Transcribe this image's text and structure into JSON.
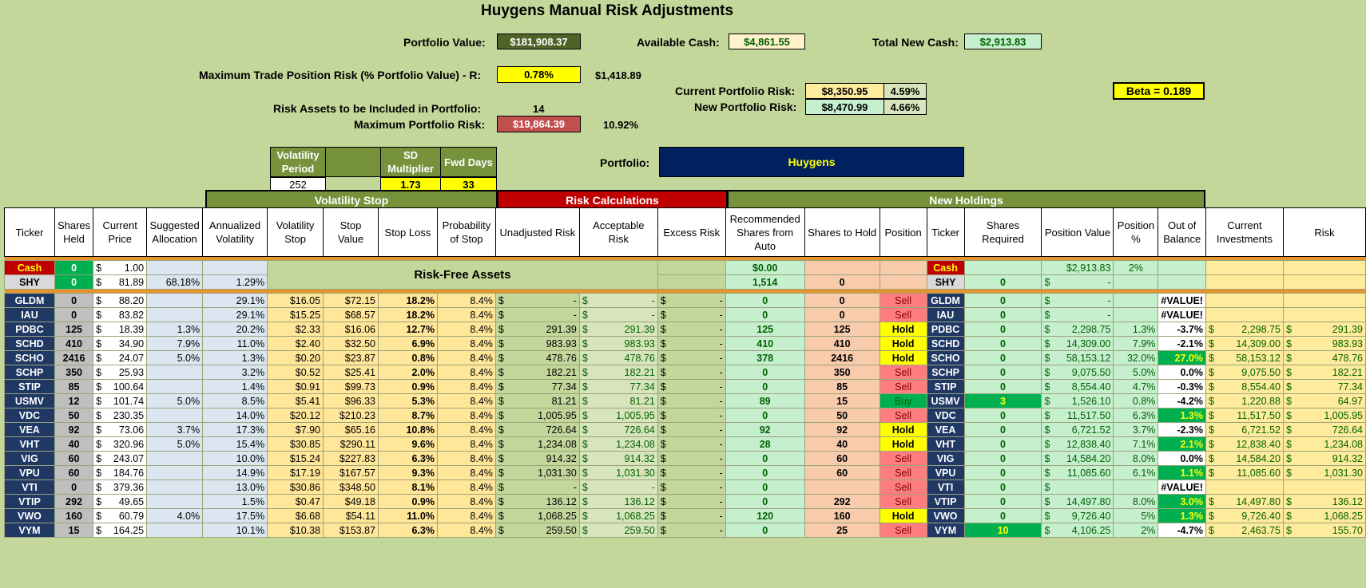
{
  "title": "Huygens Manual Risk Adjustments",
  "portfolio_value": {
    "label": "Portfolio Value:",
    "value": "$181,908.37"
  },
  "available_cash": {
    "label": "Available Cash:",
    "value": "$4,861.55"
  },
  "total_new_cash": {
    "label": "Total New Cash:",
    "value": "$2,913.83"
  },
  "max_trade_risk": {
    "label": "Maximum Trade Position Risk (% Portfolio Value) - R:",
    "pct": "0.78%",
    "amount": "$1,418.89"
  },
  "current_portfolio_risk": {
    "label": "Current Portfolio Risk:",
    "amount": "$8,350.95",
    "pct": "4.59%"
  },
  "new_portfolio_risk": {
    "label": "New Portfolio Risk:",
    "amount": "$8,470.99",
    "pct": "4.66%"
  },
  "beta": "Beta = 0.189",
  "risk_assets": {
    "label": "Risk Assets to be Included in Portfolio:",
    "value": "14"
  },
  "max_portfolio_risk": {
    "label": "Maximum Portfolio Risk:",
    "amount": "$19,864.39",
    "pct": "10.92%"
  },
  "params": {
    "vol_period_label": "Volatility Period",
    "vol_period": "252",
    "sd_label": "SD Multiplier",
    "sd": "1.73",
    "fwd_label": "Fwd Days",
    "fwd": "33"
  },
  "portfolio": {
    "label": "Portfolio:",
    "name": "Huygens"
  },
  "bands": {
    "vol_stop": "Volatility Stop",
    "risk_calc": "Risk Calculations",
    "new_holdings": "New Holdings"
  },
  "headers": [
    "Ticker",
    "Shares Held",
    "Current Price",
    "Suggested Allocation",
    "Annualized Volatility",
    "Volatility Stop",
    "Stop Value",
    "Stop Loss",
    "Probability of Stop",
    "Unadjusted Risk",
    "Acceptable Risk",
    "Excess Risk",
    "Recommended Shares from Auto",
    "Shares to Hold",
    "Position",
    "Ticker",
    "Shares Required",
    "Position Value",
    "Position %",
    "Out of Balance",
    "Current Investments",
    "Risk"
  ],
  "risk_free_label": "Risk-Free Assets",
  "cash_row": {
    "ticker": "Cash",
    "shares": "0",
    "price": "1.00",
    "rec": "$0.00",
    "ticker2": "Cash",
    "pval": "$2,913.83",
    "ppct": "2%"
  },
  "shy_row": {
    "ticker": "SHY",
    "shares": "0",
    "price": "81.89",
    "alloc": "68.18%",
    "vol": "1.29%",
    "rec": "1,514",
    "hold": "0",
    "ticker2": "SHY",
    "sreq": "0",
    "pval": "-"
  },
  "rows": [
    {
      "t": "GLDM",
      "sh": "0",
      "p": "88.20",
      "al": "",
      "av": "29.1%",
      "vs": "$16.05",
      "sv": "$72.15",
      "sl": "18.2%",
      "ps": "8.4%",
      "ur": "-",
      "ar": "-",
      "er": "-",
      "rec": "0",
      "hold": "0",
      "pos": "Sell",
      "sreq": "0",
      "pv": "-",
      "pp": "",
      "oob": "#VALUE!",
      "ci": "",
      "rk": ""
    },
    {
      "t": "IAU",
      "sh": "0",
      "p": "83.82",
      "al": "",
      "av": "29.1%",
      "vs": "$15.25",
      "sv": "$68.57",
      "sl": "18.2%",
      "ps": "8.4%",
      "ur": "-",
      "ar": "-",
      "er": "-",
      "rec": "0",
      "hold": "0",
      "pos": "Sell",
      "sreq": "0",
      "pv": "-",
      "pp": "",
      "oob": "#VALUE!",
      "ci": "",
      "rk": ""
    },
    {
      "t": "PDBC",
      "sh": "125",
      "p": "18.39",
      "al": "1.3%",
      "av": "20.2%",
      "vs": "$2.33",
      "sv": "$16.06",
      "sl": "12.7%",
      "ps": "8.4%",
      "ur": "291.39",
      "ar": "291.39",
      "er": "-",
      "rec": "125",
      "hold": "125",
      "pos": "Hold",
      "sreq": "0",
      "pv": "2,298.75",
      "pp": "1.3%",
      "oob": "-3.7%",
      "ci": "2,298.75",
      "rk": "291.39"
    },
    {
      "t": "SCHD",
      "sh": "410",
      "p": "34.90",
      "al": "7.9%",
      "av": "11.0%",
      "vs": "$2.40",
      "sv": "$32.50",
      "sl": "6.9%",
      "ps": "8.4%",
      "ur": "983.93",
      "ar": "983.93",
      "er": "-",
      "rec": "410",
      "hold": "410",
      "pos": "Hold",
      "sreq": "0",
      "pv": "14,309.00",
      "pp": "7.9%",
      "oob": "-2.1%",
      "ci": "14,309.00",
      "rk": "983.93"
    },
    {
      "t": "SCHO",
      "sh": "2416",
      "p": "24.07",
      "al": "5.0%",
      "av": "1.3%",
      "vs": "$0.20",
      "sv": "$23.87",
      "sl": "0.8%",
      "ps": "8.4%",
      "ur": "478.76",
      "ar": "478.76",
      "er": "-",
      "rec": "378",
      "hold": "2416",
      "pos": "Hold",
      "sreq": "0",
      "pv": "58,153.12",
      "pp": "32.0%",
      "oob": "27.0%",
      "ci": "58,153.12",
      "rk": "478.76"
    },
    {
      "t": "SCHP",
      "sh": "350",
      "p": "25.93",
      "al": "",
      "av": "3.2%",
      "vs": "$0.52",
      "sv": "$25.41",
      "sl": "2.0%",
      "ps": "8.4%",
      "ur": "182.21",
      "ar": "182.21",
      "er": "-",
      "rec": "0",
      "hold": "350",
      "pos": "Sell",
      "sreq": "0",
      "pv": "9,075.50",
      "pp": "5.0%",
      "oob": "0.0%",
      "ci": "9,075.50",
      "rk": "182.21"
    },
    {
      "t": "STIP",
      "sh": "85",
      "p": "100.64",
      "al": "",
      "av": "1.4%",
      "vs": "$0.91",
      "sv": "$99.73",
      "sl": "0.9%",
      "ps": "8.4%",
      "ur": "77.34",
      "ar": "77.34",
      "er": "-",
      "rec": "0",
      "hold": "85",
      "pos": "Sell",
      "sreq": "0",
      "pv": "8,554.40",
      "pp": "4.7%",
      "oob": "-0.3%",
      "ci": "8,554.40",
      "rk": "77.34"
    },
    {
      "t": "USMV",
      "sh": "12",
      "p": "101.74",
      "al": "5.0%",
      "av": "8.5%",
      "vs": "$5.41",
      "sv": "$96.33",
      "sl": "5.3%",
      "ps": "8.4%",
      "ur": "81.21",
      "ar": "81.21",
      "er": "-",
      "rec": "89",
      "hold": "15",
      "pos": "Buy",
      "sreq": "3",
      "pv": "1,526.10",
      "pp": "0.8%",
      "oob": "-4.2%",
      "ci": "1,220.88",
      "rk": "64.97"
    },
    {
      "t": "VDC",
      "sh": "50",
      "p": "230.35",
      "al": "",
      "av": "14.0%",
      "vs": "$20.12",
      "sv": "$210.23",
      "sl": "8.7%",
      "ps": "8.4%",
      "ur": "1,005.95",
      "ar": "1,005.95",
      "er": "-",
      "rec": "0",
      "hold": "50",
      "pos": "Sell",
      "sreq": "0",
      "pv": "11,517.50",
      "pp": "6.3%",
      "oob": "1.3%",
      "ci": "11,517.50",
      "rk": "1,005.95"
    },
    {
      "t": "VEA",
      "sh": "92",
      "p": "73.06",
      "al": "3.7%",
      "av": "17.3%",
      "vs": "$7.90",
      "sv": "$65.16",
      "sl": "10.8%",
      "ps": "8.4%",
      "ur": "726.64",
      "ar": "726.64",
      "er": "-",
      "rec": "92",
      "hold": "92",
      "pos": "Hold",
      "sreq": "0",
      "pv": "6,721.52",
      "pp": "3.7%",
      "oob": "-2.3%",
      "ci": "6,721.52",
      "rk": "726.64"
    },
    {
      "t": "VHT",
      "sh": "40",
      "p": "320.96",
      "al": "5.0%",
      "av": "15.4%",
      "vs": "$30.85",
      "sv": "$290.11",
      "sl": "9.6%",
      "ps": "8.4%",
      "ur": "1,234.08",
      "ar": "1,234.08",
      "er": "-",
      "rec": "28",
      "hold": "40",
      "pos": "Hold",
      "sreq": "0",
      "pv": "12,838.40",
      "pp": "7.1%",
      "oob": "2.1%",
      "ci": "12,838.40",
      "rk": "1,234.08"
    },
    {
      "t": "VIG",
      "sh": "60",
      "p": "243.07",
      "al": "",
      "av": "10.0%",
      "vs": "$15.24",
      "sv": "$227.83",
      "sl": "6.3%",
      "ps": "8.4%",
      "ur": "914.32",
      "ar": "914.32",
      "er": "-",
      "rec": "0",
      "hold": "60",
      "pos": "Sell",
      "sreq": "0",
      "pv": "14,584.20",
      "pp": "8.0%",
      "oob": "0.0%",
      "ci": "14,584.20",
      "rk": "914.32"
    },
    {
      "t": "VPU",
      "sh": "60",
      "p": "184.76",
      "al": "",
      "av": "14.9%",
      "vs": "$17.19",
      "sv": "$167.57",
      "sl": "9.3%",
      "ps": "8.4%",
      "ur": "1,031.30",
      "ar": "1,031.30",
      "er": "-",
      "rec": "0",
      "hold": "60",
      "pos": "Sell",
      "sreq": "0",
      "pv": "11,085.60",
      "pp": "6.1%",
      "oob": "1.1%",
      "ci": "11,085.60",
      "rk": "1,031.30"
    },
    {
      "t": "VTI",
      "sh": "0",
      "p": "379.36",
      "al": "",
      "av": "13.0%",
      "vs": "$30.86",
      "sv": "$348.50",
      "sl": "8.1%",
      "ps": "8.4%",
      "ur": "-",
      "ar": "-",
      "er": "-",
      "rec": "0",
      "hold": "",
      "pos": "Sell",
      "sreq": "0",
      "pv": "",
      "pp": "",
      "oob": "#VALUE!",
      "ci": "",
      "rk": ""
    },
    {
      "t": "VTIP",
      "sh": "292",
      "p": "49.65",
      "al": "",
      "av": "1.5%",
      "vs": "$0.47",
      "sv": "$49.18",
      "sl": "0.9%",
      "ps": "8.4%",
      "ur": "136.12",
      "ar": "136.12",
      "er": "-",
      "rec": "0",
      "hold": "292",
      "pos": "Sell",
      "sreq": "0",
      "pv": "14,497.80",
      "pp": "8.0%",
      "oob": "3.0%",
      "ci": "14,497.80",
      "rk": "136.12"
    },
    {
      "t": "VWO",
      "sh": "160",
      "p": "60.79",
      "al": "4.0%",
      "av": "17.5%",
      "vs": "$6.68",
      "sv": "$54.11",
      "sl": "11.0%",
      "ps": "8.4%",
      "ur": "1,068.25",
      "ar": "1,068.25",
      "er": "-",
      "rec": "120",
      "hold": "160",
      "pos": "Hold",
      "sreq": "0",
      "pv": "9,726.40",
      "pp": "5%",
      "oob": "1.3%",
      "ci": "9,726.40",
      "rk": "1,068.25"
    },
    {
      "t": "VYM",
      "sh": "15",
      "p": "164.25",
      "al": "",
      "av": "10.1%",
      "vs": "$10.38",
      "sv": "$153.87",
      "sl": "6.3%",
      "ps": "8.4%",
      "ur": "259.50",
      "ar": "259.50",
      "er": "-",
      "rec": "0",
      "hold": "25",
      "pos": "Sell",
      "sreq": "10",
      "pv": "4,106.25",
      "pp": "2%",
      "oob": "-4.7%",
      "ci": "2,463.75",
      "rk": "155.70"
    }
  ],
  "colors": {
    "background": "#c4d79b",
    "ticker": "#1f3864",
    "banner": "#002060",
    "band_green": "#76933c",
    "band_red": "#c00000"
  }
}
